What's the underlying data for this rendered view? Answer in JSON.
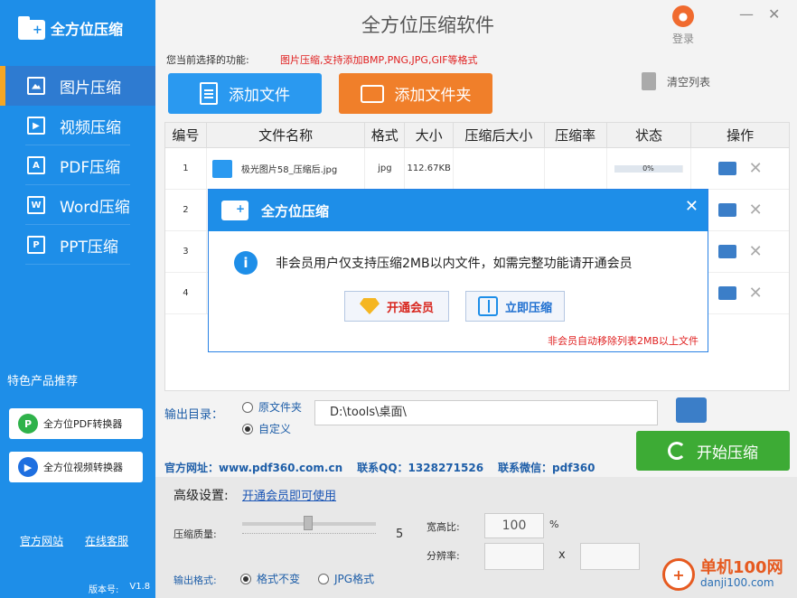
{
  "brand": {
    "name": "全方位压缩"
  },
  "nav": [
    {
      "label": "图片压缩",
      "icon": "image-icon"
    },
    {
      "label": "视频压缩",
      "icon": "video-icon"
    },
    {
      "label": "PDF压缩",
      "icon": "pdf-icon"
    },
    {
      "label": "Word压缩",
      "icon": "word-icon"
    },
    {
      "label": "PPT压缩",
      "icon": "ppt-icon"
    }
  ],
  "featured": {
    "title": "特色产品推荐",
    "items": [
      {
        "label": "全方位PDF转换器",
        "icon": "pdf-converter-icon"
      },
      {
        "label": "全方位视频转换器",
        "icon": "video-converter-icon"
      }
    ]
  },
  "footer_links": [
    "官方网站",
    "在线客服"
  ],
  "version": {
    "label": "版本号:",
    "value": "V1.8"
  },
  "header": {
    "title": "全方位压缩软件",
    "login": "登录"
  },
  "func": {
    "label": "您当前选择的功能:",
    "value": "图片压缩,支持添加BMP,PNG,JPG,GIF等格式"
  },
  "toolbar": {
    "add_file": "添加文件",
    "add_folder": "添加文件夹",
    "clear": "清空列表"
  },
  "table": {
    "headers": [
      "编号",
      "文件名称",
      "格式",
      "大小",
      "压缩后大小",
      "压缩率",
      "状态",
      "操作"
    ],
    "rows": [
      {
        "num": "1",
        "name": "极光图片58_压缩后.jpg",
        "format": "jpg",
        "size": "112.67KB",
        "progress_text": "0%"
      },
      {
        "num": "2"
      },
      {
        "num": "3"
      },
      {
        "num": "4"
      }
    ]
  },
  "output": {
    "label": "输出目录：",
    "option1": "原文件夹",
    "option2": "自定义",
    "path": "D:\\tools\\桌面\\"
  },
  "start": "开始压缩",
  "contact": {
    "site": "官方网址：www.pdf360.com.cn",
    "qq": "联系QQ：1328271526",
    "wechat": "联系微信：pdf360"
  },
  "advanced": {
    "title": "高级设置:",
    "link": "开通会员即可使用",
    "quality_label": "压缩质量:",
    "quality_value": "5",
    "aspect_label": "宽高比:",
    "aspect_value": "100",
    "aspect_unit": "%",
    "resolution_label": "分辨率:",
    "resolution_x": "x",
    "format_label": "输出格式:",
    "format_opt1": "格式不变",
    "format_opt2": "JPG格式"
  },
  "modal": {
    "title": "全方位压缩",
    "message": "非会员用户仅支持压缩2MB以内文件，如需完整功能请开通会员",
    "btn_vip": "开通会员",
    "btn_compress": "立即压缩",
    "note": "非会员自动移除列表2MB以上文件"
  },
  "watermark": {
    "name": "单机100网",
    "url": "danji100.com"
  },
  "colors": {
    "sidebar": "#1e8ee8",
    "accent_orange": "#f07f2a",
    "start_green": "#3dab35",
    "warning_red": "#e02020"
  }
}
